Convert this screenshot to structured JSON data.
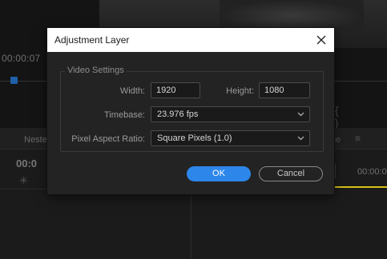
{
  "background": {
    "timecode_top": "00:00:07",
    "timecode_right": "00:00:0",
    "left_panel_tab": "Neste",
    "left_panel_timecode": "00:0",
    "right_panel_tab": "ne",
    "brackets": "{ }"
  },
  "dialog": {
    "title": "Adjustment Layer",
    "group_title": "Video Settings",
    "width_label": "Width:",
    "width_value": "1920",
    "height_label": "Height:",
    "height_value": "1080",
    "timebase_label": "Timebase:",
    "timebase_value": "23.976 fps",
    "par_label": "Pixel Aspect Ratio:",
    "par_value": "Square Pixels (1.0)",
    "ok_label": "OK",
    "cancel_label": "Cancel"
  },
  "colors": {
    "accent": "#2d86ea",
    "timeline_marker": "#d8c21a"
  }
}
